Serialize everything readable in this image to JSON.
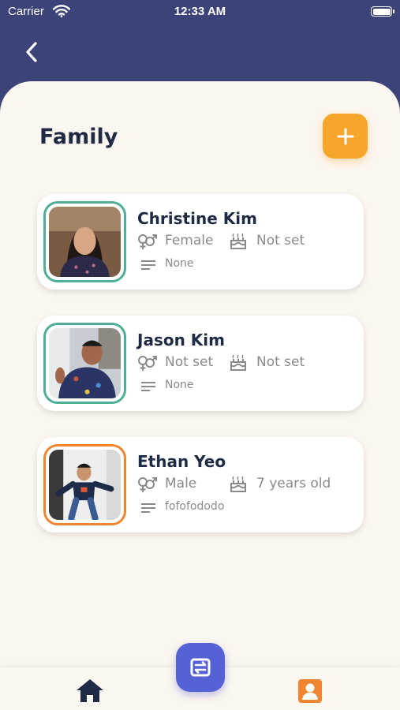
{
  "status_bar": {
    "carrier": "Carrier",
    "time": "12:33 AM"
  },
  "page": {
    "title": "Family"
  },
  "members": [
    {
      "name": "Christine Kim",
      "gender": "Female",
      "age": "Not set",
      "notes": "None",
      "frame_color": "#4fae98"
    },
    {
      "name": "Jason Kim",
      "gender": "Not set",
      "age": "Not set",
      "notes": "None",
      "frame_color": "#4fae98"
    },
    {
      "name": "Ethan Yeo",
      "gender": "Male",
      "age": "7 years old",
      "notes": "fofofododo",
      "frame_color": "#ef8530"
    }
  ],
  "icons": {
    "back": "chevron-left-icon",
    "add": "plus-icon",
    "gender": "gender-icon",
    "age": "birthday-cake-icon",
    "notes": "notes-lines-icon",
    "home_tab": "home-icon",
    "sync": "sync-icon",
    "profile_tab": "profile-icon"
  },
  "colors": {
    "header": "#3b4379",
    "background": "#fcf6f0",
    "accent_orange": "#f6a62a",
    "accent_blue": "#5561d4",
    "title_text": "#1f2a44"
  }
}
